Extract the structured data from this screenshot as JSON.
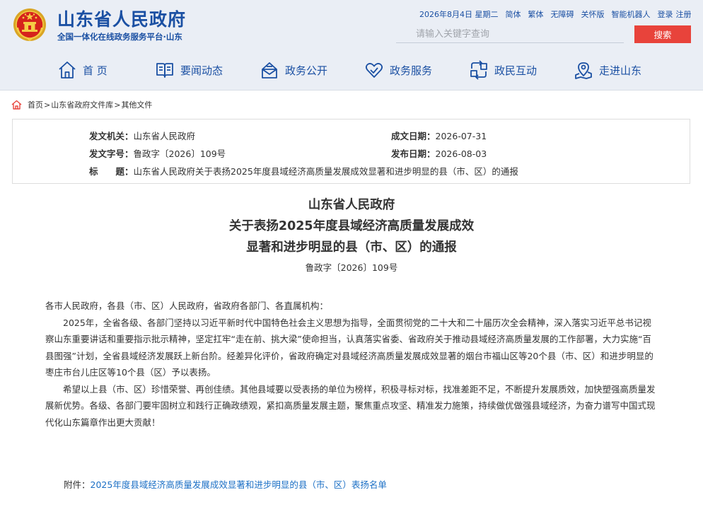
{
  "site": {
    "title": "山东省人民政府",
    "subtitle": "全国一体化在线政务服务平台·山东",
    "emblem_icon": "national-emblem-icon"
  },
  "topbar": {
    "date": "2026年8月4日 星期二",
    "links": [
      "简体",
      "繁体",
      "无障碍",
      "关怀版",
      "智能机器人",
      "登录",
      "注册"
    ]
  },
  "search": {
    "placeholder": "请输入关键字查询",
    "button_label": "搜索"
  },
  "nav": {
    "items": [
      {
        "label": "首 页",
        "icon": "home-icon"
      },
      {
        "label": "要闻动态",
        "icon": "book-icon"
      },
      {
        "label": "政务公开",
        "icon": "mailbox-icon"
      },
      {
        "label": "政务服务",
        "icon": "heart-icon"
      },
      {
        "label": "政民互动",
        "icon": "interaction-icon"
      },
      {
        "label": "走进山东",
        "icon": "location-pin-icon"
      }
    ]
  },
  "breadcrumb": {
    "items": [
      "首页",
      "山东省政府文件库",
      "其他文件"
    ],
    "separator": ">"
  },
  "info": {
    "issuer_label": "发文机关：",
    "issuer": "山东省人民政府",
    "doc_no_label": "发文字号：",
    "doc_no": "鲁政字〔2026〕109号",
    "title_label": "标　　题：",
    "title": "山东省人民政府关于表扬2025年度县域经济高质量发展成效显著和进步明显的县（市、区）的通报",
    "date_written_label": "成文日期：",
    "date_written": "2026-07-31",
    "date_published_label": "发布日期：",
    "date_published": "2026-08-03"
  },
  "document": {
    "title_lines": [
      "山东省人民政府",
      "关于表扬2025年度县域经济高质量发展成效",
      "显著和进步明显的县（市、区）的通报"
    ],
    "number": "鲁政字〔2026〕109号",
    "salutation": "各市人民政府，各县（市、区）人民政府，省政府各部门、各直属机构：",
    "paragraphs": [
      "2025年，全省各级、各部门坚持以习近平新时代中国特色社会主义思想为指导，全面贯彻党的二十大和二十届历次全会精神，深入落实习近平总书记视察山东重要讲话和重要指示批示精神，坚定扛牢“走在前、挑大梁”使命担当，认真落实省委、省政府关于推动县域经济高质量发展的工作部署，大力实施“百县图强”计划，全省县域经济发展跃上新台阶。经差异化评价，省政府确定对县域经济高质量发展成效显著的烟台市福山区等20个县（市、区）和进步明显的枣庄市台儿庄区等10个县（区）予以表扬。",
      "希望以上县（市、区）珍惜荣誉、再创佳绩。其他县域要以受表扬的单位为榜样，积极寻标对标，找准差距不足，不断提升发展质效，加快塑强高质量发展新优势。各级、各部门要牢固树立和践行正确政绩观，紧扣高质量发展主题，聚焦重点攻坚、精准发力施策，持续做优做强县域经济，为奋力谱写中国式现代化山东篇章作出更大贡献！"
    ],
    "attachment_label": "附件：",
    "attachment_link": "2025年度县域经济高质量发展成效显著和进步明显的县（市、区）表扬名单"
  },
  "colors": {
    "brand_blue": "#1b50a3",
    "header_bg": "#eaeef5",
    "search_button": "#e8433b",
    "link_blue": "#1b6fc5"
  }
}
